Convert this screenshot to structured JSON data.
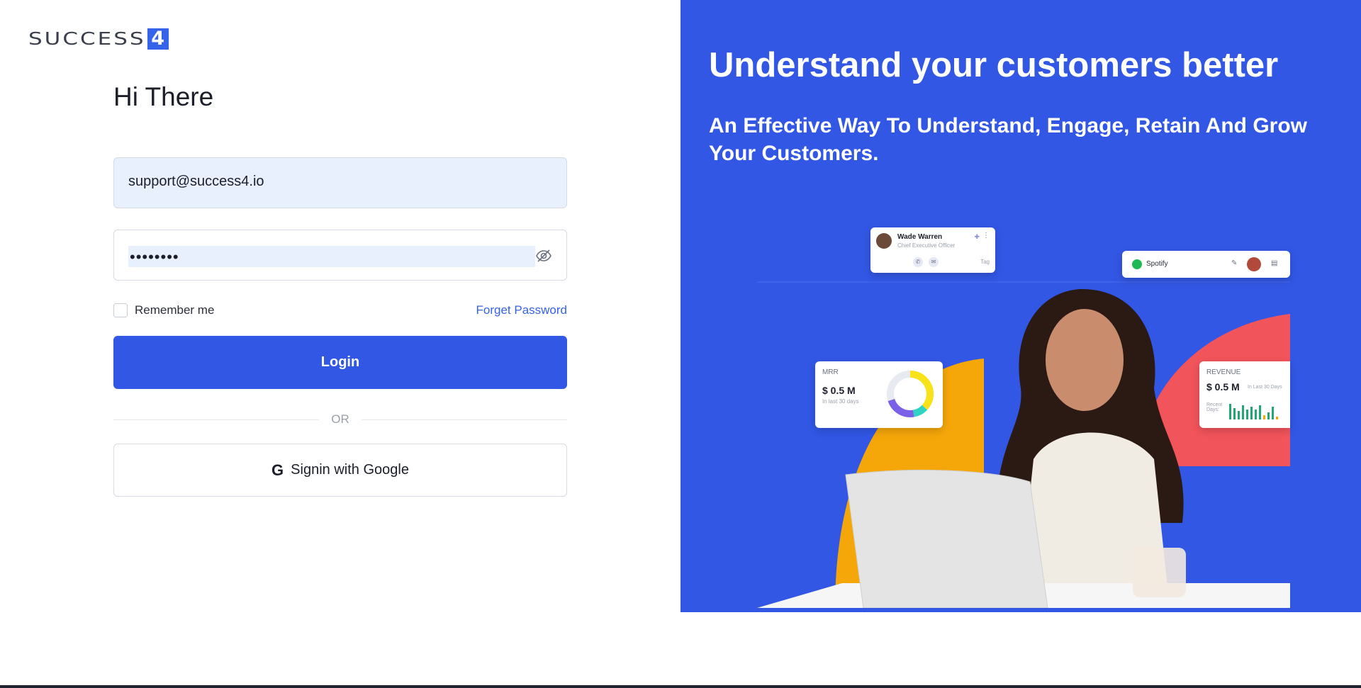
{
  "brand": {
    "logo_text": "SUCCESS",
    "logo_mark": "4"
  },
  "login": {
    "title": "Hi There",
    "email_value": "support@success4.io",
    "password_value": "••••••••",
    "remember_label": "Remember me",
    "forget_label": "Forget Password",
    "login_label": "Login",
    "or_label": "OR",
    "google_label": "Signin with Google",
    "google_icon": "G"
  },
  "promo": {
    "headline": "Understand your customers better",
    "subheadline": "An Effective Way To Understand, Engage, Retain And Grow Your Customers.",
    "contact_card": {
      "name": "Wade Warren",
      "role": "Chief Executive Officer",
      "tag": "Tag"
    },
    "company_card": {
      "name": "Spotify"
    },
    "mrr_card": {
      "label": "MRR",
      "value": "$ 0.5 M",
      "period": "In last 30 days"
    },
    "revenue_card": {
      "label": "REVENUE",
      "value": "$ 0.5 M",
      "period": "In Last 30 Days",
      "recent": "Recent Days:"
    }
  },
  "colors": {
    "accent": "#3257e5",
    "orange": "#f5a70a",
    "coral": "#f2545b"
  }
}
